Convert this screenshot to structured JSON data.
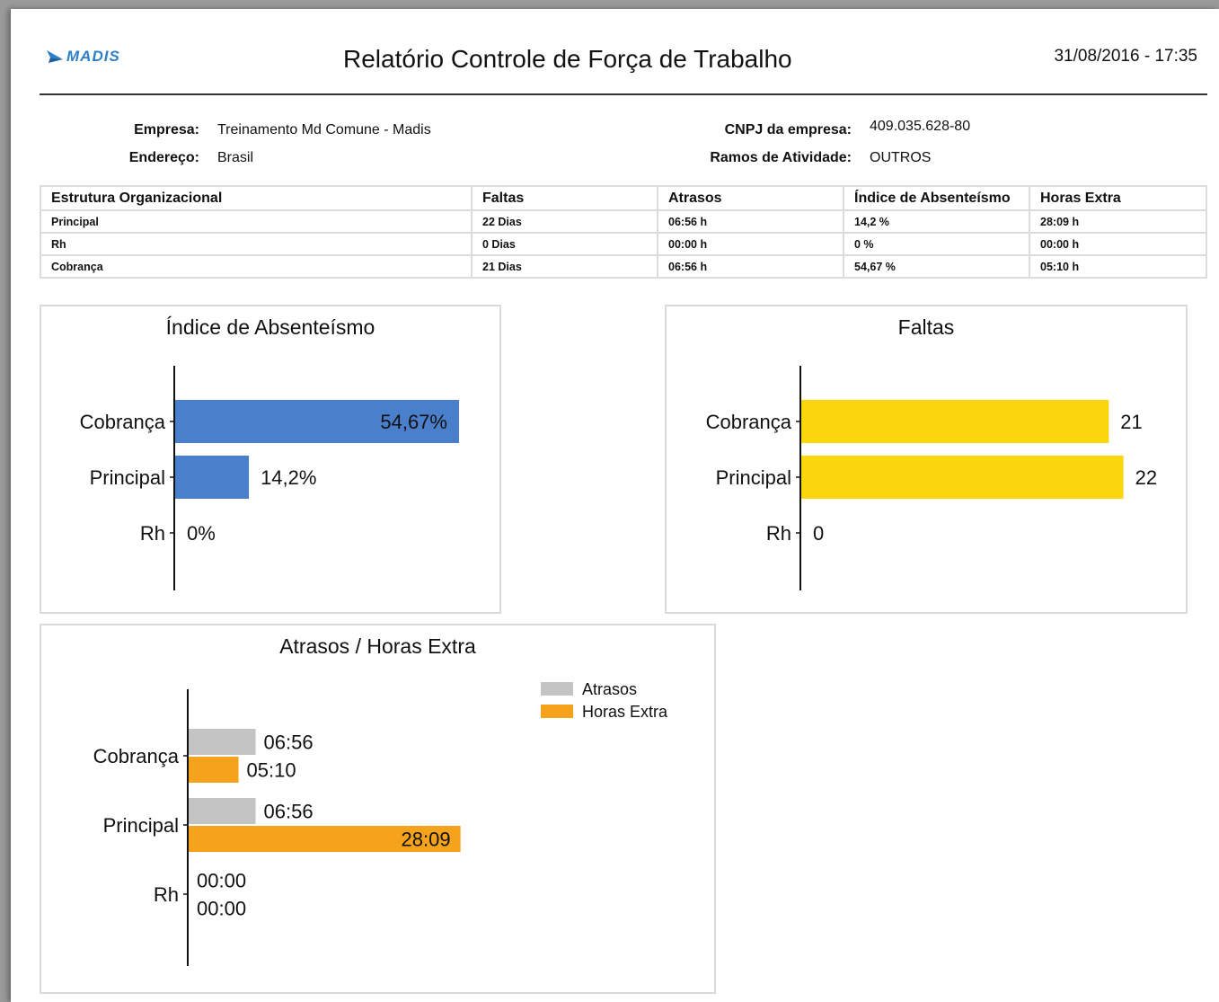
{
  "header": {
    "logo_text": "MADIS",
    "title": "Relatório Controle de Força de Trabalho",
    "datetime": "31/08/2016 - 17:35"
  },
  "company": {
    "empresa_label": "Empresa:",
    "empresa_value": "Treinamento Md Comune - Madis",
    "endereco_label": "Endereço:",
    "endereco_value": "Brasil",
    "cnpj_label": "CNPJ da empresa:",
    "cnpj_value": "409.035.628-80",
    "ramos_label": "Ramos de Atividade:",
    "ramos_value": "OUTROS"
  },
  "table": {
    "headers": [
      "Estrutura Organizacional",
      "Faltas",
      "Atrasos",
      "Índice de Absenteísmo",
      "Horas Extra"
    ],
    "rows": [
      [
        "Principal",
        "22 Dias",
        "06:56 h",
        "14,2 %",
        "28:09 h"
      ],
      [
        "Rh",
        "0 Dias",
        "00:00 h",
        "0 %",
        "00:00 h"
      ],
      [
        "Cobrança",
        "21 Dias",
        "06:56 h",
        "54,67 %",
        "05:10 h"
      ]
    ]
  },
  "colors": {
    "absenteismo": "#4a7fcb",
    "faltas": "#fad60d",
    "atrasos": "#c4c4c4",
    "horas_extra": "#f5a31c"
  },
  "chart_data": [
    {
      "type": "bar",
      "orientation": "horizontal",
      "title": "Índice de Absenteísmo",
      "categories": [
        "Cobrança",
        "Principal",
        "Rh"
      ],
      "values": [
        54.67,
        14.2,
        0
      ],
      "labels": [
        "54,67%",
        "14,2%",
        "0%"
      ],
      "xlim": [
        0,
        60
      ]
    },
    {
      "type": "bar",
      "orientation": "horizontal",
      "title": "Faltas",
      "categories": [
        "Cobrança",
        "Principal",
        "Rh"
      ],
      "values": [
        21,
        22,
        0
      ],
      "labels": [
        "21",
        "22",
        "0"
      ],
      "xlim": [
        0,
        24
      ]
    },
    {
      "type": "bar",
      "orientation": "horizontal",
      "title": "Atrasos / Horas Extra",
      "categories": [
        "Cobrança",
        "Principal",
        "Rh"
      ],
      "series": [
        {
          "name": "Atrasos",
          "values": [
            6.933,
            6.933,
            0
          ],
          "labels": [
            "06:56",
            "06:56",
            "00:00"
          ]
        },
        {
          "name": "Horas Extra",
          "values": [
            5.167,
            28.15,
            0
          ],
          "labels": [
            "05:10",
            "28:09",
            "00:00"
          ]
        }
      ],
      "legend": "top-right",
      "unit": "hours"
    }
  ]
}
